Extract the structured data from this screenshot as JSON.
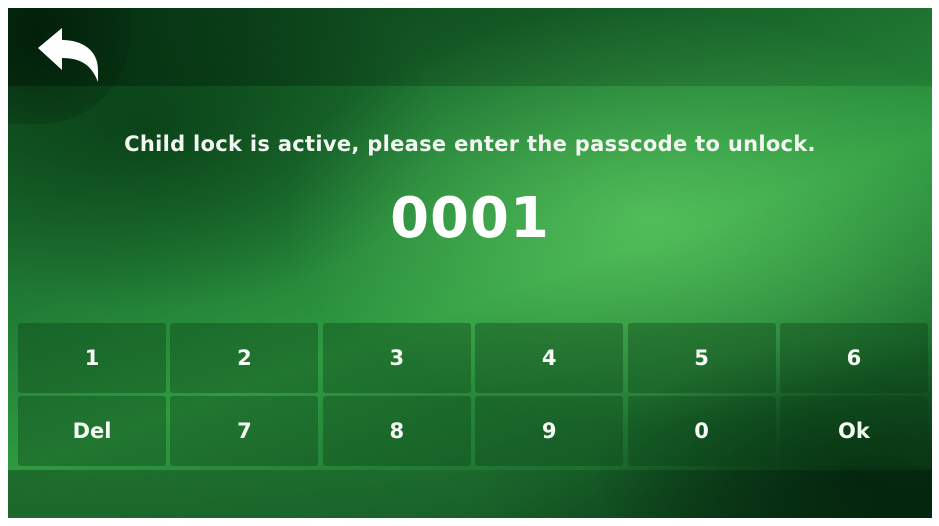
{
  "header": {
    "back_icon": "back-arrow-icon"
  },
  "lock": {
    "message": "Child lock is active, please enter the passcode to unlock.",
    "passcode": "0001"
  },
  "keypad": {
    "keys": [
      {
        "label": "1",
        "name": "key-1"
      },
      {
        "label": "2",
        "name": "key-2"
      },
      {
        "label": "3",
        "name": "key-3"
      },
      {
        "label": "4",
        "name": "key-4"
      },
      {
        "label": "5",
        "name": "key-5"
      },
      {
        "label": "6",
        "name": "key-6"
      },
      {
        "label": "Del",
        "name": "key-delete"
      },
      {
        "label": "7",
        "name": "key-7"
      },
      {
        "label": "8",
        "name": "key-8"
      },
      {
        "label": "9",
        "name": "key-9"
      },
      {
        "label": "0",
        "name": "key-0"
      },
      {
        "label": "Ok",
        "name": "key-ok"
      }
    ]
  },
  "colors": {
    "background": "#2f9a41",
    "text": "#ffffff"
  }
}
